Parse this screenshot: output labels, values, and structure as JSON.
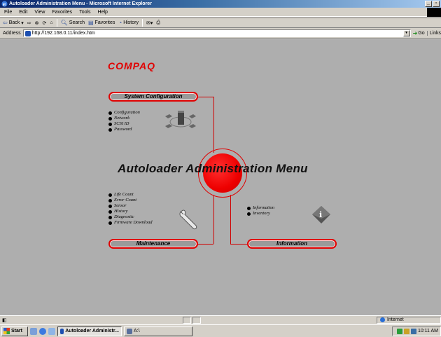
{
  "window": {
    "title": "Autoloader Administration Menu - Microsoft Internet Explorer",
    "minimize": "_",
    "maximize": "▫"
  },
  "menubar": [
    "File",
    "Edit",
    "View",
    "Favorites",
    "Tools",
    "Help"
  ],
  "toolbar": {
    "back": "Back",
    "search": "Search",
    "favorites": "Favorites",
    "history": "History"
  },
  "address": {
    "label": "Address",
    "url": "http://192.168.0.11/index.htm",
    "go": "Go",
    "links": "Links"
  },
  "page": {
    "logo": "COMPAQ",
    "title": "Autoloader Administration Menu",
    "system_configuration": {
      "label": "System Configuration",
      "items": [
        "Configuration",
        "Network",
        "SCSI ID",
        "Password"
      ]
    },
    "maintenance": {
      "label": "Maintenance",
      "items": [
        "Life Count",
        "Error Count",
        "Sensor",
        "History",
        "Diagnostic",
        "Firmware Download"
      ]
    },
    "information": {
      "label": "Information",
      "items": [
        "Information",
        "Inventory"
      ]
    },
    "accent_color": "#e00000",
    "background_color": "#aeaeae"
  },
  "statusbar": {
    "zone": "Internet"
  },
  "taskbar": {
    "start": "Start",
    "tasks": [
      "Autoloader Administr...",
      "A:\\"
    ],
    "clock": "10:11 AM"
  }
}
